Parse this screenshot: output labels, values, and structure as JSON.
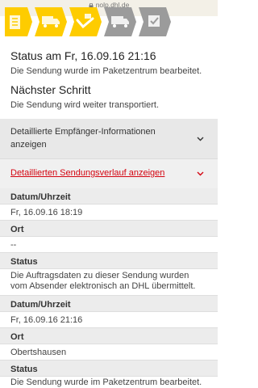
{
  "browser": {
    "url": "nolp.dhl.de"
  },
  "progress_icons": [
    "parcel-icon",
    "truck-icon",
    "handover-icon",
    "van-icon",
    "delivery-check-icon"
  ],
  "status": {
    "title": "Status am Fr, 16.09.16 21:16",
    "text": "Die Sendung wurde im Paketzentrum bearbeitet."
  },
  "next_step": {
    "title": "Nächster Schritt",
    "text": "Die Sendung wird weiter transportiert."
  },
  "recipient_toggle": {
    "label_line1": "Detaillierte Empfänger-Informationen",
    "label_line2": "anzeigen"
  },
  "history_toggle": {
    "label": "Detaillierten Sendungsverlauf anzeigen"
  },
  "history": {
    "labels": {
      "datetime": "Datum/Uhrzeit",
      "place": "Ort",
      "status": "Status"
    },
    "entries": [
      {
        "datetime": "Fr, 16.09.16 18:19",
        "place": "--",
        "status_line1": "Die Auftragsdaten zu dieser Sendung wurden",
        "status_line2": "vom Absender elektronisch an DHL übermittelt."
      },
      {
        "datetime": "Fr, 16.09.16 21:16",
        "place": "Obertshausen",
        "status_line1": "Die Sendung wurde im Paketzentrum bearbeitet."
      }
    ]
  },
  "colors": {
    "dhl_yellow": "#fecc00",
    "dhl_red": "#d40511",
    "inactive_grey": "#9b9b9b"
  }
}
